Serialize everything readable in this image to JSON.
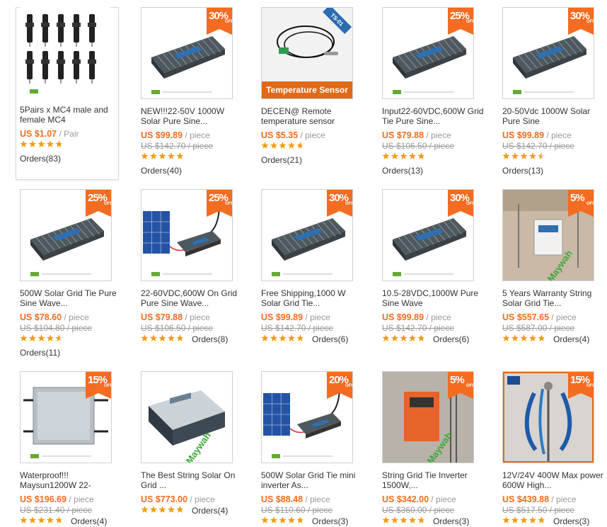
{
  "products": [
    {
      "title": "5Pairs x MC4 male and female MC4",
      "price": "US $1.07",
      "unit": "/ Pair",
      "orig": "",
      "stars": 4.8,
      "orders": "Orders(83)",
      "discount": "",
      "off": "",
      "icon": "mc4-connectors-icon"
    },
    {
      "title": "NEW!!!22-50V 1000W Solar Pure Sine...",
      "price": "US $99.89",
      "unit": "/ piece",
      "orig": "US $142.70 / piece",
      "stars": 4.8,
      "orders": "Orders(40)",
      "discount": "30%",
      "off": "OFF",
      "icon": "grid-tie-inverter-icon"
    },
    {
      "title": "DECEN@ Remote temperature sensor",
      "price": "US $5.35",
      "unit": "/ piece",
      "orig": "",
      "stars": 4.7,
      "orders": "Orders(21)",
      "discount": "",
      "off": "",
      "icon": "temperature-sensor-icon",
      "overlay_title": "Temperature Sensor",
      "corner_tag": "TS-01"
    },
    {
      "title": "Input22-60VDC,600W Grid Tie Pure Sine...",
      "price": "US $79.88",
      "unit": "/ piece",
      "orig": "US $106.50 / piece",
      "stars": 4.8,
      "orders": "Orders(13)",
      "discount": "25%",
      "off": "OFF",
      "icon": "grid-tie-inverter-icon"
    },
    {
      "title": "20-50Vdc 1000W Solar Pure Sine",
      "price": "US $99.89",
      "unit": "/ piece",
      "orig": "US $142.70 / piece",
      "stars": 4.5,
      "orders": "Orders(13)",
      "discount": "30%",
      "off": "OFF",
      "icon": "grid-tie-inverter-icon"
    },
    {
      "title": "500W Solar Grid Tie Pure Sine Wave...",
      "price": "US $78.60",
      "unit": "/ piece",
      "orig": "US $104.80 / piece",
      "stars": 4.6,
      "orders": "Orders(11)",
      "discount": "25%",
      "off": "OFF",
      "icon": "grid-tie-inverter-icon"
    },
    {
      "title": "22-60VDC,600W On Grid Pure Sine Wave...",
      "price": "US $79.88",
      "unit": "/ piece",
      "orig": "US $106.50 / piece",
      "stars": 4.8,
      "orders": "Orders(8)",
      "discount": "25%",
      "off": "OFF",
      "icon": "inverter-with-panel-icon"
    },
    {
      "title": "Free Shipping,1000 W Solar Grid Tie...",
      "price": "US $99.89",
      "unit": "/ piece",
      "orig": "US $142.70 / piece",
      "stars": 4.8,
      "orders": "Orders(6)",
      "discount": "30%",
      "off": "OFF",
      "icon": "grid-tie-inverter-icon"
    },
    {
      "title": "10.5-28VDC,1000W Pure Sine Wave",
      "price": "US $99.89",
      "unit": "/ piece",
      "orig": "US $142.70 / piece",
      "stars": 4.8,
      "orders": "Orders(6)",
      "discount": "30%",
      "off": "OFF",
      "icon": "grid-tie-inverter-icon"
    },
    {
      "title": "5 Years Warranty String Solar Grid Tie...",
      "price": "US $557.65",
      "unit": "/ piece",
      "orig": "US $587.00 / piece",
      "stars": 4.8,
      "orders": "Orders(4)",
      "discount": "5%",
      "off": "OFF",
      "icon": "string-inverter-icon",
      "watermark": "Maywah"
    },
    {
      "title": "Waterproof!!! Maysun1200W 22-",
      "price": "US $196.69",
      "unit": "/ piece",
      "orig": "US $231.40 / piece",
      "stars": 4.8,
      "orders": "Orders(4)",
      "discount": "15%",
      "off": "OFF",
      "icon": "micro-inverter-icon"
    },
    {
      "title": "The Best String Solar On Grid ...",
      "price": "US $773.00",
      "unit": "/ piece",
      "orig": "",
      "stars": 4.8,
      "orders": "Orders(4)",
      "discount": "",
      "off": "",
      "icon": "string-inverter-icon",
      "watermark": "Maywah"
    },
    {
      "title": "500W Solar Grid Tie mini inverter As...",
      "price": "US $88.48",
      "unit": "/ piece",
      "orig": "US $110.60 / piece",
      "stars": 4.8,
      "orders": "Orders(3)",
      "discount": "20%",
      "off": "OFF",
      "icon": "inverter-with-panel-icon"
    },
    {
      "title": "String Grid Tie Inverter 1500W,...",
      "price": "US $342.00",
      "unit": "/ piece",
      "orig": "US $360.00 / piece",
      "stars": 4.8,
      "orders": "Orders(3)",
      "discount": "5%",
      "off": "OFF",
      "icon": "string-inverter-icon",
      "watermark": "Maywah"
    },
    {
      "title": "12V/24V 400W Max power 600W High...",
      "price": "US $439.88",
      "unit": "/ piece",
      "orig": "US $517.50 / piece",
      "stars": 4.8,
      "orders": "Orders(3)",
      "discount": "15%",
      "off": "OFF",
      "icon": "wind-turbine-icon"
    }
  ],
  "colors": {
    "price": "#f36c21",
    "badge": "#f36c21",
    "star": "#f39c12",
    "muted": "#999999"
  }
}
